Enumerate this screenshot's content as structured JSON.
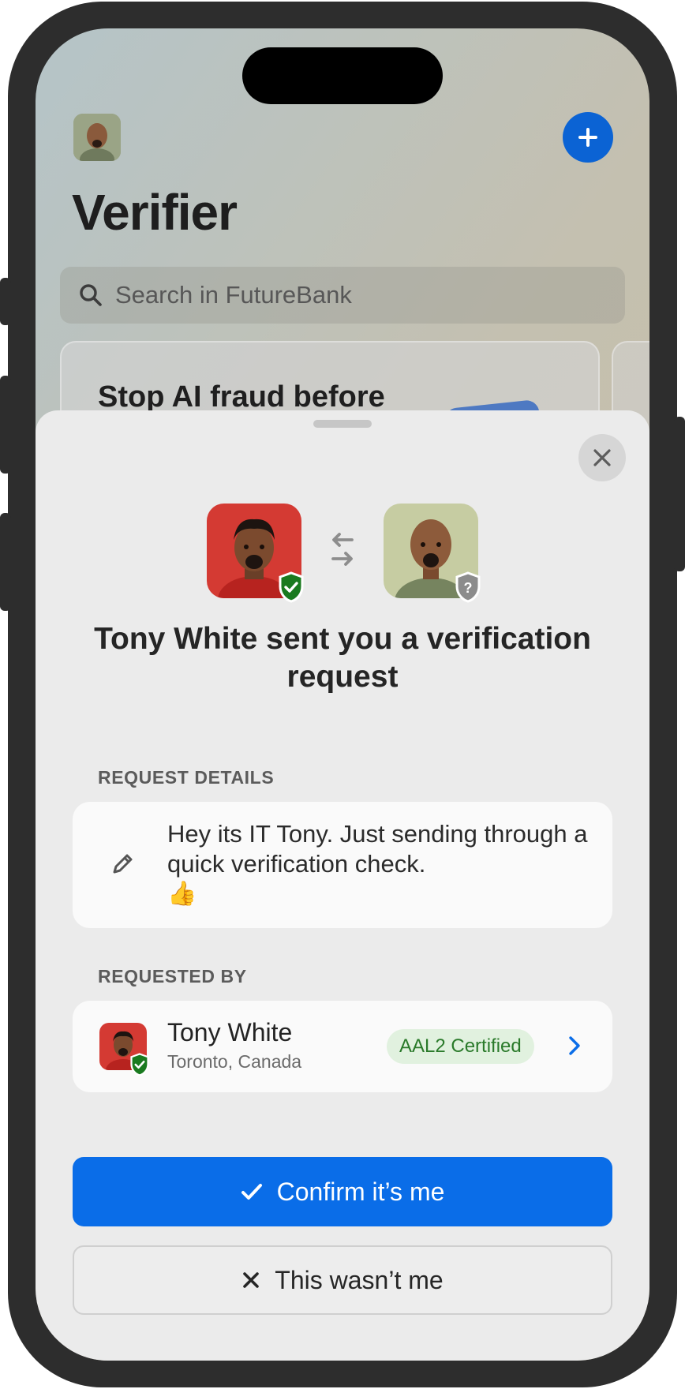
{
  "app": {
    "title": "Verifier",
    "search_placeholder": "Search in FutureBank",
    "promo_title": "Stop AI fraud before",
    "add_icon": "plus-icon",
    "accent": "#0b63d4"
  },
  "sheet": {
    "close_icon": "close-icon",
    "title": "Tony White sent you a verification request",
    "sender_avatar_color": "#d43a33",
    "recipient_avatar_color": "#c6cca2",
    "swap_icon": "swap-arrows-icon",
    "request_details": {
      "label": "REQUEST DETAILS",
      "message": "Hey its IT Tony. Just sending through a quick verification check.",
      "emoji": "👍",
      "icon": "pencil-icon"
    },
    "requested_by": {
      "label": "REQUESTED BY",
      "name": "Tony White",
      "location": "Toronto, Canada",
      "badge": "AAL2 Certified",
      "badge_color": "#2a7a2a"
    },
    "confirm_label": "Confirm it’s me",
    "deny_label": "This wasn’t me",
    "confirm_color": "#0a6de8"
  }
}
